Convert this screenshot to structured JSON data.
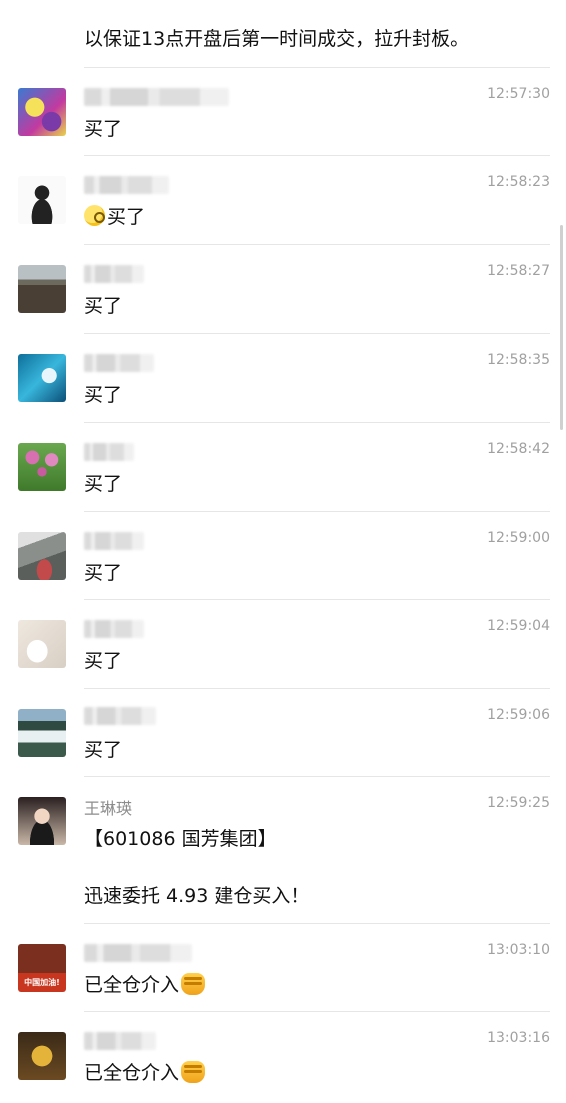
{
  "top_message": "以保证13点开盘后第一时间成交，拉升封板。",
  "colors": {
    "divider": "#e6e6e6",
    "time": "#a0a0a0",
    "name": "#8c8c8c",
    "text": "#111111"
  },
  "messages": [
    {
      "time": "12:57:30",
      "text": "买了",
      "avatar": "cartoon-avatar-icon"
    },
    {
      "time": "12:58:23",
      "text": "买了",
      "emoji": "thinking-face-emoji",
      "avatar": "person-sketch-avatar-icon"
    },
    {
      "time": "12:58:27",
      "text": "买了",
      "avatar": "landscape-avatar-icon"
    },
    {
      "time": "12:58:35",
      "text": "买了",
      "avatar": "wave-avatar-icon"
    },
    {
      "time": "12:58:42",
      "text": "买了",
      "avatar": "flowers-avatar-icon"
    },
    {
      "time": "12:59:00",
      "text": "买了",
      "avatar": "mountain-avatar-icon"
    },
    {
      "time": "12:59:04",
      "text": "买了",
      "avatar": "bride-avatar-icon"
    },
    {
      "time": "12:59:06",
      "text": "买了",
      "avatar": "waterfall-avatar-icon"
    },
    {
      "time": "12:59:25",
      "name": "王琳瑛",
      "line1": "【601086 国芳集团】",
      "line2": "迅速委托 4.93 建仓买入！",
      "avatar": "woman-portrait-avatar-icon"
    },
    {
      "time": "13:03:10",
      "text": "已全仓介入",
      "emoji": "fist-emoji",
      "avatar": "room-avatar-icon",
      "avatar_caption": "中国加油!"
    },
    {
      "time": "13:03:16",
      "text": "已全仓介入",
      "emoji": "fist-emoji",
      "avatar": "pharaoh-avatar-icon"
    }
  ]
}
